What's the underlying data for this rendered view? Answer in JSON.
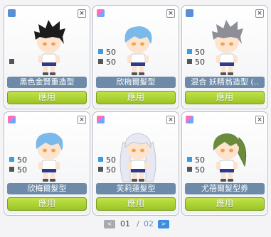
{
  "cards": [
    {
      "gender": "male",
      "hair": "#1c1c1c",
      "hairStyle": "spiky",
      "stat_blue": "",
      "stat_gray": "",
      "name": "黑色金賢重造型",
      "apply": "應用"
    },
    {
      "gender": "mixed",
      "hair": "#7ab9ea",
      "hairStyle": "short",
      "stat_blue": "50",
      "stat_gray": "50",
      "name": "欣梅爾髮型",
      "apply": "應用"
    },
    {
      "gender": "male",
      "hair": "#8e8e96",
      "hairStyle": "spiky",
      "stat_blue": "50",
      "stat_gray": "50",
      "name": "混合 妖精翁造型 (..",
      "apply": "應用"
    },
    {
      "gender": "mixed",
      "hair": "#7ab9ea",
      "hairStyle": "short",
      "stat_blue": "50",
      "stat_gray": "50",
      "name": "欣梅爾髮型",
      "apply": "應用"
    },
    {
      "gender": "mixed",
      "hair": "#e6e8f3",
      "hairStyle": "long",
      "stat_blue": "50",
      "stat_gray": "50",
      "name": "芙莉蓮髮型",
      "apply": "應用"
    },
    {
      "gender": "mixed",
      "hair": "#6a8c3a",
      "hairStyle": "tail",
      "stat_blue": "50",
      "stat_gray": "50",
      "name": "尤蓓爾髮型券",
      "apply": "應用"
    }
  ],
  "pager": {
    "current": "01",
    "separator": "/",
    "total": "02",
    "prev": "<",
    "next": ">"
  },
  "close_glyph": "×"
}
